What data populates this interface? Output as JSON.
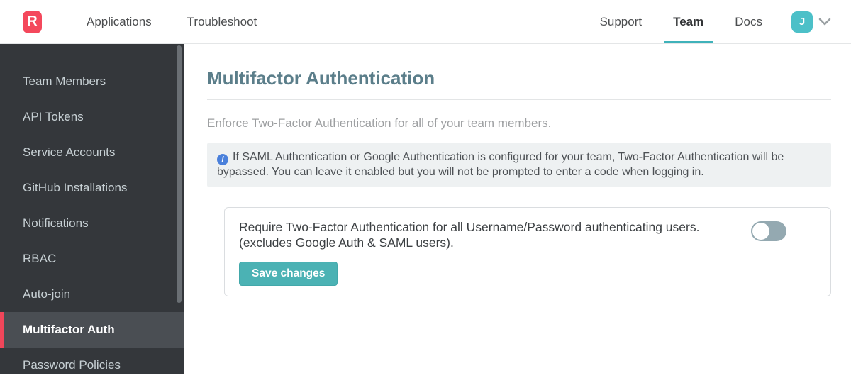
{
  "nav": {
    "logo_letter": "R",
    "left_items": [
      {
        "label": "Applications"
      },
      {
        "label": "Troubleshoot"
      }
    ],
    "right_items": [
      {
        "label": "Support",
        "active": false
      },
      {
        "label": "Team",
        "active": true
      },
      {
        "label": "Docs",
        "active": false
      }
    ],
    "avatar_initial": "J"
  },
  "sidebar": {
    "items": [
      {
        "label": "Team Members",
        "active": false
      },
      {
        "label": "API Tokens",
        "active": false
      },
      {
        "label": "Service Accounts",
        "active": false
      },
      {
        "label": "GitHub Installations",
        "active": false
      },
      {
        "label": "Notifications",
        "active": false
      },
      {
        "label": "RBAC",
        "active": false
      },
      {
        "label": "Auto-join",
        "active": false
      },
      {
        "label": "Multifactor Auth",
        "active": true
      },
      {
        "label": "Password Policies",
        "active": false
      }
    ]
  },
  "main": {
    "title": "Multifactor Authentication",
    "description": "Enforce Two-Factor Authentication for all of your team members.",
    "info_note": "If SAML Authentication or Google Authentication is configured for your team, Two-Factor Authentication will be bypassed. You can leave it enabled but you will not be prompted to enter a code when logging in.",
    "card": {
      "label_line1": "Require Two-Factor Authentication for all Username/Password authenticating users.",
      "label_line2": "(excludes Google Auth & SAML users).",
      "toggle_state": "off",
      "save_label": "Save changes"
    }
  },
  "colors": {
    "brand_red": "#f4485c",
    "accent_teal": "#4bb2b4",
    "avatar_teal": "#4cc0c8",
    "nav_active_underline": "#3fb2ba",
    "sidebar_bg": "#34373b",
    "sidebar_active_bg": "#4a4e53",
    "sidebar_active_border": "#f0465a",
    "heading_teal": "#5b7e8a",
    "info_box_bg": "#eef1f2",
    "info_icon_blue": "#4a80db",
    "toggle_off": "#94a9b1"
  }
}
